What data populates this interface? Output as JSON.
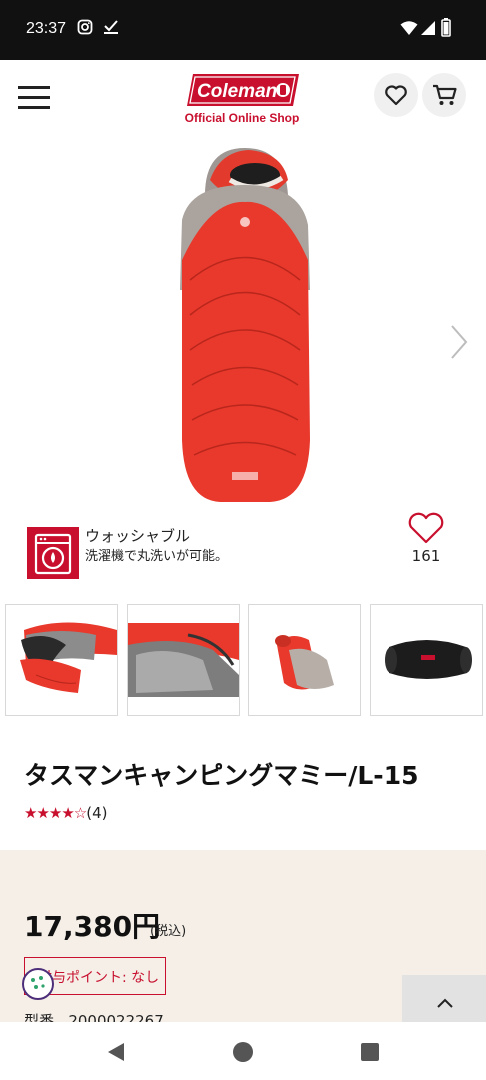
{
  "status_bar": {
    "time": "23:37"
  },
  "header": {
    "brand": "Coleman",
    "subtitle": "Official Online Shop"
  },
  "feature": {
    "title": "ウォッシャブル",
    "description": "洗濯機で丸洗いが可能。"
  },
  "favorite": {
    "count": "161"
  },
  "thumbnails": [
    {
      "name": "thumb-interior-open"
    },
    {
      "name": "thumb-hood-detail"
    },
    {
      "name": "thumb-rolled"
    },
    {
      "name": "thumb-stuff-bag"
    }
  ],
  "product": {
    "title": "タスマンキャンピングマミー/L-15",
    "stars": "★★★★☆",
    "rating": 4,
    "review_count": "(4)",
    "price": "17,380円",
    "tax_note": "(税込)",
    "points": "付与ポイント: なし",
    "sku_label": "型番",
    "sku_value": "2000022267"
  },
  "colors": {
    "brand_red": "#c8102e",
    "price_bg": "#f5efe8",
    "status_bg": "#111111"
  }
}
